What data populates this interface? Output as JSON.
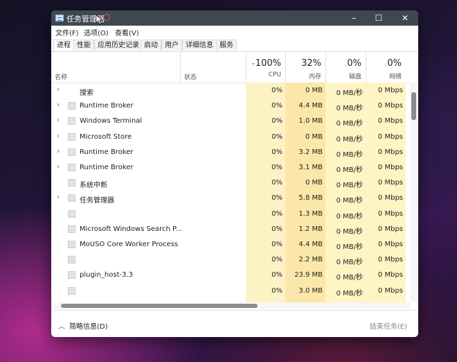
{
  "window": {
    "title": "任务管理器",
    "controls": {
      "minimize": "–",
      "maximize": "☐",
      "close": "✕"
    }
  },
  "menu": [
    "文件(F)",
    "选项(O)",
    "查看(V)"
  ],
  "tabs": [
    "进程",
    "性能",
    "应用历史记录",
    "启动",
    "用户",
    "详细信息",
    "服务"
  ],
  "active_tab": "进程",
  "columns": {
    "name": "名称",
    "status": "状态",
    "cpu": {
      "percent": "100%",
      "label": "CPU"
    },
    "memory": {
      "percent": "32%",
      "label": "内存"
    },
    "disk": {
      "percent": "0%",
      "label": "磁盘"
    },
    "network": {
      "percent": "0%",
      "label": "网络"
    }
  },
  "rows": [
    {
      "expand": true,
      "icon": false,
      "name": "搜索",
      "cpu": "0%",
      "mem": "0 MB",
      "disk": "0 MB/秒",
      "net": "0 Mbps"
    },
    {
      "expand": true,
      "icon": true,
      "name": "Runtime Broker",
      "cpu": "0%",
      "mem": "4.4 MB",
      "disk": "0 MB/秒",
      "net": "0 Mbps"
    },
    {
      "expand": true,
      "icon": true,
      "name": "Windows Terminal",
      "cpu": "0%",
      "mem": "1.0 MB",
      "disk": "0 MB/秒",
      "net": "0 Mbps"
    },
    {
      "expand": true,
      "icon": true,
      "name": "Microsoft Store",
      "cpu": "0%",
      "mem": "0 MB",
      "disk": "0 MB/秒",
      "net": "0 Mbps"
    },
    {
      "expand": true,
      "icon": true,
      "name": "Runtime Broker",
      "cpu": "0%",
      "mem": "3.2 MB",
      "disk": "0 MB/秒",
      "net": "0 Mbps"
    },
    {
      "expand": true,
      "icon": true,
      "name": "Runtime Broker",
      "cpu": "0%",
      "mem": "3.1 MB",
      "disk": "0 MB/秒",
      "net": "0 Mbps"
    },
    {
      "expand": false,
      "icon": true,
      "name": "系统中断",
      "cpu": "0%",
      "mem": "0 MB",
      "disk": "0 MB/秒",
      "net": "0 Mbps"
    },
    {
      "expand": true,
      "icon": true,
      "name": "任务管理器",
      "cpu": "0%",
      "mem": "5.8 MB",
      "disk": "0 MB/秒",
      "net": "0 Mbps"
    },
    {
      "expand": false,
      "icon": true,
      "name": "",
      "cpu": "0%",
      "mem": "1.3 MB",
      "disk": "0 MB/秒",
      "net": "0 Mbps"
    },
    {
      "expand": false,
      "icon": true,
      "name": "Microsoft Windows Search P...",
      "cpu": "0%",
      "mem": "1.2 MB",
      "disk": "0 MB/秒",
      "net": "0 Mbps"
    },
    {
      "expand": false,
      "icon": true,
      "name": "MoUSO Core Worker Process",
      "cpu": "0%",
      "mem": "4.4 MB",
      "disk": "0 MB/秒",
      "net": "0 Mbps"
    },
    {
      "expand": false,
      "icon": true,
      "name": "",
      "cpu": "0%",
      "mem": "2.2 MB",
      "disk": "0 MB/秒",
      "net": "0 Mbps"
    },
    {
      "expand": false,
      "icon": true,
      "name": "plugin_host-3.3",
      "cpu": "0%",
      "mem": "23.9 MB",
      "disk": "0 MB/秒",
      "net": "0 Mbps"
    },
    {
      "expand": false,
      "icon": true,
      "name": "",
      "cpu": "0%",
      "mem": "3.0 MB",
      "disk": "0 MB/秒",
      "net": "0 Mbps"
    }
  ],
  "footer": {
    "fewer_details": "简略信息(D)",
    "end_task": "结束任务(E)"
  },
  "colors": {
    "titlebar": "#3f4750",
    "cpu_heat": "#fdf2c4",
    "mem_heat": "#fbe7a9",
    "other_heat": "#fff4c4"
  }
}
